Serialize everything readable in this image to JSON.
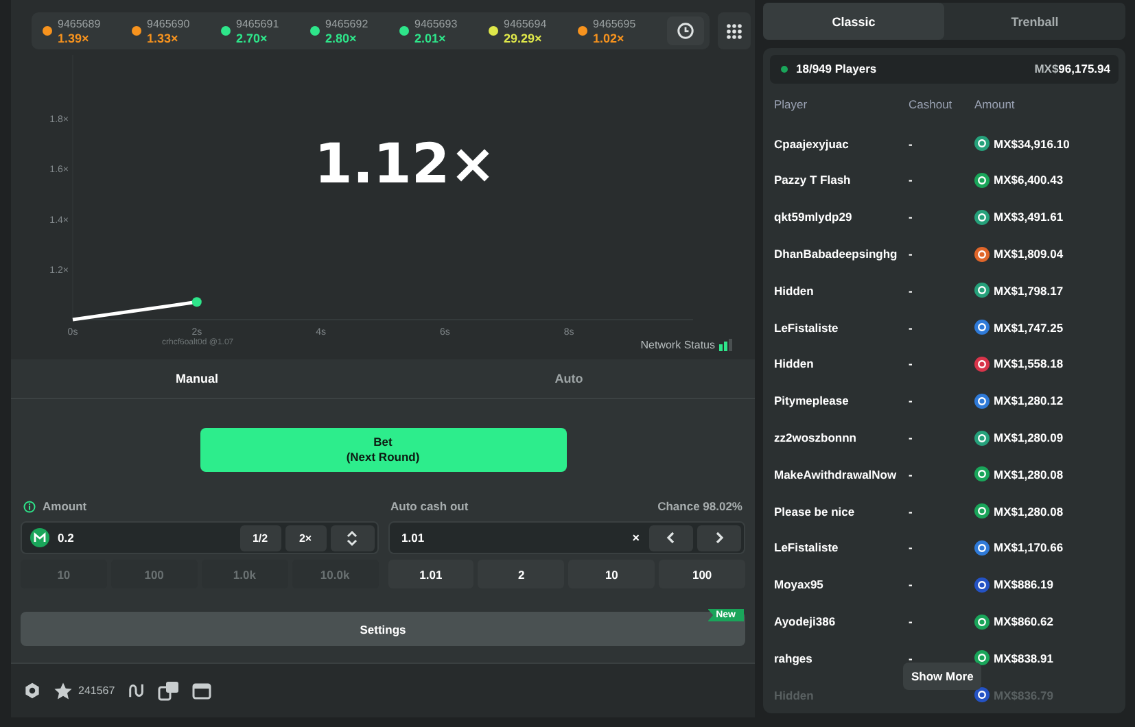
{
  "history": [
    {
      "round": "9465689",
      "multiplier": "1.39×",
      "color": "#f7931e"
    },
    {
      "round": "9465690",
      "multiplier": "1.33×",
      "color": "#f7931e"
    },
    {
      "round": "9465691",
      "multiplier": "2.70×",
      "color": "#2ee58a"
    },
    {
      "round": "9465692",
      "multiplier": "2.80×",
      "color": "#2ee58a"
    },
    {
      "round": "9465693",
      "multiplier": "2.01×",
      "color": "#2ee58a"
    },
    {
      "round": "9465694",
      "multiplier": "29.29×",
      "color": "#dfe84a"
    },
    {
      "round": "9465695",
      "multiplier": "1.02×",
      "color": "#f7931e"
    }
  ],
  "game": {
    "multiplier": "1.12×",
    "cashout_marker": "crhcf6oalt0d @1.07",
    "network_status": "Network Status",
    "chart_data": {
      "type": "line",
      "x": [
        0,
        2
      ],
      "series": [
        {
          "color": "#ffffff",
          "values": [
            1.0,
            1.07
          ]
        }
      ],
      "xlim": [
        0,
        10
      ],
      "ylim": [
        1.0,
        2.05
      ],
      "xticks": [
        {
          "value": 0,
          "label": "0s"
        },
        {
          "value": 2,
          "label": "2s"
        },
        {
          "value": 4,
          "label": "4s"
        },
        {
          "value": 6,
          "label": "6s"
        },
        {
          "value": 8,
          "label": "8s"
        }
      ],
      "yticks": [
        {
          "value": 1.2,
          "label": "1.2×"
        },
        {
          "value": 1.4,
          "label": "1.4×"
        },
        {
          "value": 1.6,
          "label": "1.6×"
        },
        {
          "value": 1.8,
          "label": "1.8×"
        }
      ]
    }
  },
  "mode_tabs": [
    {
      "label": "Manual",
      "selected": true
    },
    {
      "label": "Auto",
      "selected": false
    }
  ],
  "bet_button": [
    "Bet",
    "(Next Round)"
  ],
  "amount": {
    "label": "Amount",
    "value": "0.2",
    "half": "1/2",
    "double": "2×",
    "presets": [
      {
        "label": "10",
        "disabled": true
      },
      {
        "label": "100",
        "disabled": true
      },
      {
        "label": "1.0k",
        "disabled": true
      },
      {
        "label": "10.0k",
        "disabled": true
      }
    ]
  },
  "auto_cashout": {
    "label": "Auto cash out",
    "chance": "Chance 98.02%",
    "value": "1.01",
    "suffix": "×",
    "presets": [
      {
        "label": "1.01",
        "disabled": false
      },
      {
        "label": "2",
        "disabled": false
      },
      {
        "label": "10",
        "disabled": false
      },
      {
        "label": "100",
        "disabled": false
      }
    ]
  },
  "settings": {
    "label": "Settings",
    "badge": "New"
  },
  "toolbar": {
    "favorites": "241567"
  },
  "board_tabs": [
    {
      "label": "Classic",
      "selected": true
    },
    {
      "label": "Trenball",
      "selected": false
    }
  ],
  "summary": {
    "players": "18/949 Players",
    "currency": "MX$",
    "total": "96,175.94"
  },
  "columns": [
    "Player",
    "Cashout",
    "Amount"
  ],
  "players": [
    {
      "name": "Cpaajexyjuac",
      "cashout": "-",
      "amount": "MX$34,916.10",
      "color": "#26a17b",
      "faded": false
    },
    {
      "name": "Pazzy T Flash",
      "cashout": "-",
      "amount": "MX$6,400.43",
      "color": "#1aa55a",
      "faded": false
    },
    {
      "name": "qkt59mlydp29",
      "cashout": "-",
      "amount": "MX$3,491.61",
      "color": "#26a17b",
      "faded": false
    },
    {
      "name": "DhanBabadeepsinghg",
      "cashout": "-",
      "amount": "MX$1,809.04",
      "color": "#e0662a",
      "faded": false
    },
    {
      "name": "Hidden",
      "cashout": "-",
      "amount": "MX$1,798.17",
      "color": "#26a17b",
      "faded": false
    },
    {
      "name": "LeFistaliste",
      "cashout": "-",
      "amount": "MX$1,747.25",
      "color": "#2f7ad8",
      "faded": false
    },
    {
      "name": "Hidden",
      "cashout": "-",
      "amount": "MX$1,558.18",
      "color": "#d8344a",
      "faded": false
    },
    {
      "name": "Pitymeplease",
      "cashout": "-",
      "amount": "MX$1,280.12",
      "color": "#2f7ad8",
      "faded": false
    },
    {
      "name": "zz2woszbonnn",
      "cashout": "-",
      "amount": "MX$1,280.09",
      "color": "#26a17b",
      "faded": false
    },
    {
      "name": "MakeAwithdrawalNow",
      "cashout": "-",
      "amount": "MX$1,280.08",
      "color": "#1aa55a",
      "faded": false
    },
    {
      "name": "Please be nice",
      "cashout": "-",
      "amount": "MX$1,280.08",
      "color": "#1aa55a",
      "faded": false
    },
    {
      "name": "LeFistaliste",
      "cashout": "-",
      "amount": "MX$1,170.66",
      "color": "#2f7ad8",
      "faded": false
    },
    {
      "name": "Moyax95",
      "cashout": "-",
      "amount": "MX$886.19",
      "color": "#2452c4",
      "faded": false
    },
    {
      "name": "Ayodeji386",
      "cashout": "-",
      "amount": "MX$860.62",
      "color": "#1aa55a",
      "faded": false
    },
    {
      "name": "rahges",
      "cashout": "-",
      "amount": "MX$838.91",
      "color": "#1aa55a",
      "faded": false
    },
    {
      "name": "Hidden",
      "amount": "MX$836.79",
      "color": "#2452c4",
      "faded": true
    }
  ],
  "show_more": "Show More"
}
